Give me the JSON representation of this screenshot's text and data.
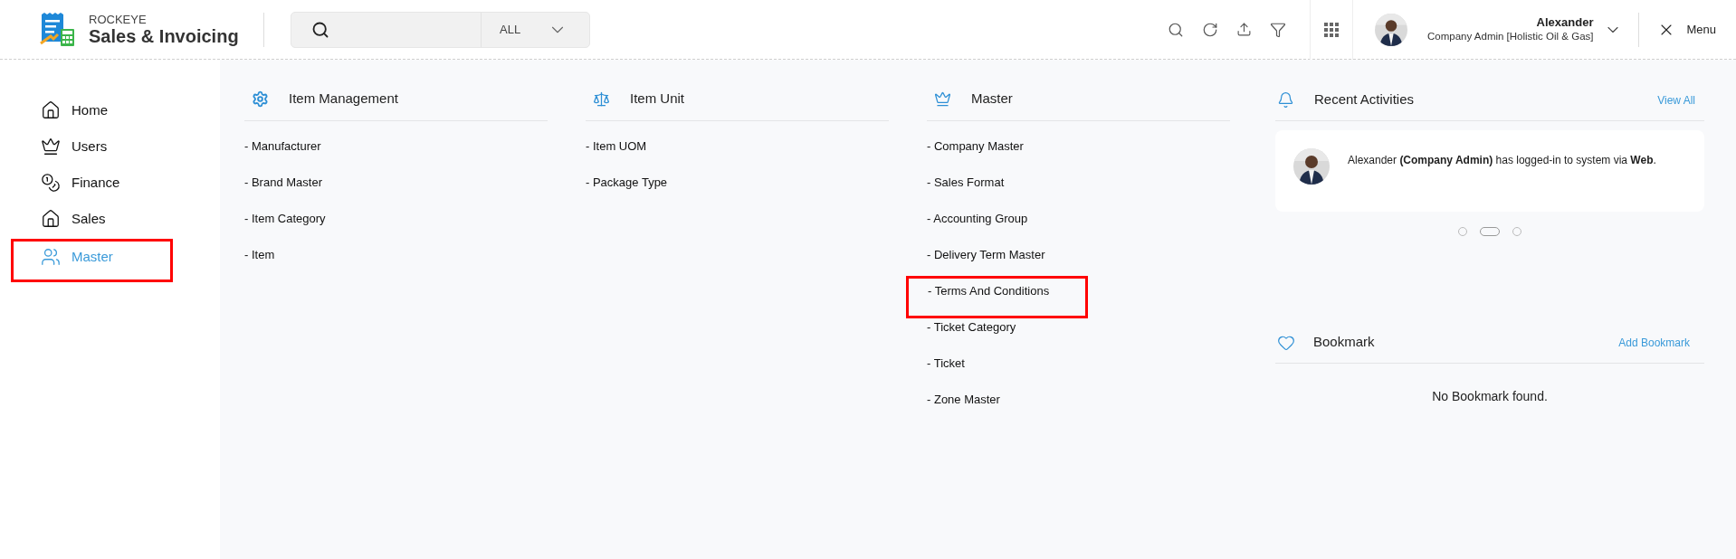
{
  "brand": {
    "top": "ROCKEYE",
    "name": "Sales & Invoicing"
  },
  "search": {
    "scope": "ALL"
  },
  "user": {
    "name": "Alexander",
    "role": "Company Admin [Holistic Oil & Gas]"
  },
  "menu_button": "Menu",
  "sidebar": [
    {
      "label": "Home",
      "selected": false,
      "highlighted": false
    },
    {
      "label": "Users",
      "selected": false,
      "highlighted": false
    },
    {
      "label": "Finance",
      "selected": false,
      "highlighted": false
    },
    {
      "label": "Sales",
      "selected": false,
      "highlighted": false
    },
    {
      "label": "Master",
      "selected": true,
      "highlighted": true
    }
  ],
  "columns": [
    {
      "title": "Item Management",
      "items": [
        {
          "label": "- Manufacturer",
          "highlighted": false
        },
        {
          "label": "- Brand Master",
          "highlighted": false
        },
        {
          "label": "- Item Category",
          "highlighted": false
        },
        {
          "label": "- Item",
          "highlighted": false
        }
      ]
    },
    {
      "title": "Item Unit",
      "items": [
        {
          "label": "- Item UOM",
          "highlighted": false
        },
        {
          "label": "- Package Type",
          "highlighted": false
        }
      ]
    },
    {
      "title": "Master",
      "items": [
        {
          "label": "- Company Master",
          "highlighted": false
        },
        {
          "label": "- Sales Format",
          "highlighted": false
        },
        {
          "label": "- Accounting Group",
          "highlighted": false
        },
        {
          "label": "- Delivery Term Master",
          "highlighted": false
        },
        {
          "label": "- Terms And Conditions",
          "highlighted": true
        },
        {
          "label": "- Ticket Category",
          "highlighted": false
        },
        {
          "label": "- Ticket",
          "highlighted": false
        },
        {
          "label": "- Zone Master",
          "highlighted": false
        }
      ]
    }
  ],
  "recent": {
    "title": "Recent Activities",
    "link": "View All",
    "activity": "Alexander **(Company Admin)** has logged-in to system via **Web**.",
    "dots": [
      {
        "selected": false
      },
      {
        "selected": true
      },
      {
        "selected": false
      }
    ]
  },
  "bookmark": {
    "title": "Bookmark",
    "link": "Add Bookmark",
    "empty": "No Bookmark found."
  }
}
